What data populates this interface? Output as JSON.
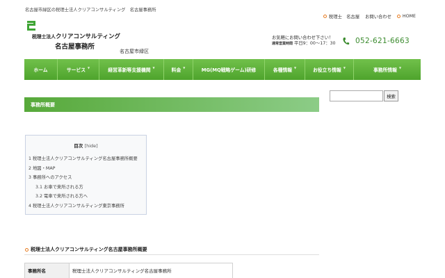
{
  "header": {
    "tagline": "名古屋市緑区の税理士法人クリアコンサルティング　名古屋事務所",
    "top_links": [
      {
        "label": "税理士　名古屋"
      },
      {
        "label": "お問い合わせ"
      },
      {
        "label": "HOME"
      }
    ],
    "logo_line1_small": "税理士法人",
    "logo_line1_main": "クリアコンサルティング",
    "logo_line2": "名古屋事務所",
    "area": "名古屋市緑区",
    "contact_line1": "お気軽にお問い合わせ下さい！",
    "contact_hours_label": "通常営業時間",
    "contact_hours": "平日9：00～17：30",
    "phone": "052-621-6663"
  },
  "nav": {
    "items": [
      {
        "label": "ホーム",
        "caret": false
      },
      {
        "label": "サービス",
        "caret": true
      },
      {
        "label": "経営革新等支援機関",
        "caret": true
      },
      {
        "label": "料金",
        "caret": true
      },
      {
        "label": "MG(MQ戦略ゲーム)研修",
        "caret": false
      },
      {
        "label": "各種情報",
        "caret": true
      },
      {
        "label": "お役立ち情報",
        "caret": true
      },
      {
        "label": "事務所情報",
        "caret": true
      }
    ]
  },
  "main": {
    "section_title": "事務所概要",
    "toc": {
      "title": "目次",
      "hide_label": "[hide]",
      "items": [
        {
          "label": "1 税理士法人クリアコンサルティング名古屋事務所概要",
          "sub": false
        },
        {
          "label": "2 地図・MAP",
          "sub": false
        },
        {
          "label": "3 事務所へのアクセス",
          "sub": false
        },
        {
          "label": "3.1 お車で来所される方",
          "sub": true
        },
        {
          "label": "3.2 電車で来所される方へ",
          "sub": true
        },
        {
          "label": "4 税理士法人クリアコンサルティング東京事務所",
          "sub": false
        }
      ]
    },
    "heading2": "税理士法人クリアコンサルティング名古屋事務所概要",
    "table": {
      "rows": [
        {
          "label": "事務所名",
          "value": "税理士法人クリアコンサルティング名古屋事務所"
        }
      ]
    }
  },
  "sidebar": {
    "search_placeholder": "",
    "search_button": "検索"
  },
  "colors": {
    "nav_green_top": "#71c04b",
    "nav_green_bottom": "#4ea42c",
    "accent_orange": "#e67a1e",
    "phone_green": "#3b8b2e"
  }
}
